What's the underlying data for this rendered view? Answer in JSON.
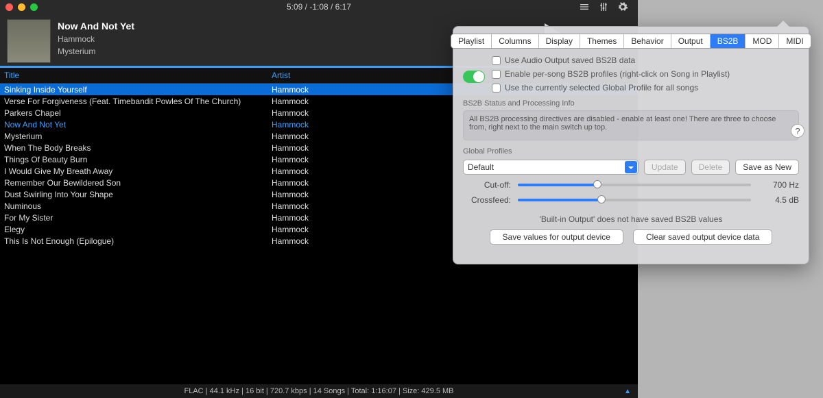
{
  "titlebar": {
    "time": "5:09 / -1:08 / 6:17"
  },
  "nowplaying": {
    "title": "Now And Not Yet",
    "artist": "Hammock",
    "album": "Mysterium"
  },
  "columns": {
    "title": "Title",
    "artist": "Artist"
  },
  "playlist": [
    {
      "title": "Sinking Inside Yourself",
      "artist": "Hammock",
      "selected": true
    },
    {
      "title": "Verse For Forgiveness (Feat. Timebandit Powles Of The Church)",
      "artist": "Hammock"
    },
    {
      "title": "Parkers Chapel",
      "artist": "Hammock"
    },
    {
      "title": "Now And Not Yet",
      "artist": "Hammock",
      "playing": true
    },
    {
      "title": "Mysterium",
      "artist": "Hammock"
    },
    {
      "title": "When The Body Breaks",
      "artist": "Hammock"
    },
    {
      "title": "Things Of Beauty Burn",
      "artist": "Hammock"
    },
    {
      "title": "I Would Give My Breath Away",
      "artist": "Hammock"
    },
    {
      "title": "Remember Our Bewildered Son",
      "artist": "Hammock"
    },
    {
      "title": "Dust Swirling Into Your Shape",
      "artist": "Hammock"
    },
    {
      "title": "Numinous",
      "artist": "Hammock"
    },
    {
      "title": "For My Sister",
      "artist": "Hammock"
    },
    {
      "title": "Elegy",
      "artist": "Hammock"
    },
    {
      "title": "This Is Not Enough  (Epilogue)",
      "artist": "Hammock"
    }
  ],
  "statusbar": "FLAC | 44.1 kHz | 16 bit | 720.7 kbps | 14 Songs | Total: 1:16:07 | Size: 429.5 MB",
  "prefs": {
    "tabs": [
      "Playlist",
      "Columns",
      "Display",
      "Themes",
      "Behavior",
      "Output",
      "BS2B",
      "MOD",
      "MIDI"
    ],
    "active_tab": "BS2B",
    "checks": {
      "c1": "Use Audio Output saved BS2B data",
      "c2": "Enable per-song BS2B profiles (right-click on Song in Playlist)",
      "c3": "Use the currently selected Global Profile for all songs"
    },
    "status_label": "BS2B Status and Processing Info",
    "status_text": "All BS2B processing directives are disabled - enable at least one! There are three to choose from, right next to the main switch up top.",
    "profiles_label": "Global Profiles",
    "profile_selected": "Default",
    "buttons": {
      "update": "Update",
      "delete": "Delete",
      "savenew": "Save as New",
      "save_device": "Save values for output device",
      "clear_device": "Clear saved output device data"
    },
    "sliders": {
      "cutoff": {
        "label": "Cut-off:",
        "value": "700 Hz",
        "pct": 34
      },
      "crossfeed": {
        "label": "Crossfeed:",
        "value": "4.5 dB",
        "pct": 36
      }
    },
    "note": "'Built-in Output' does not have saved BS2B values",
    "help": "?"
  }
}
